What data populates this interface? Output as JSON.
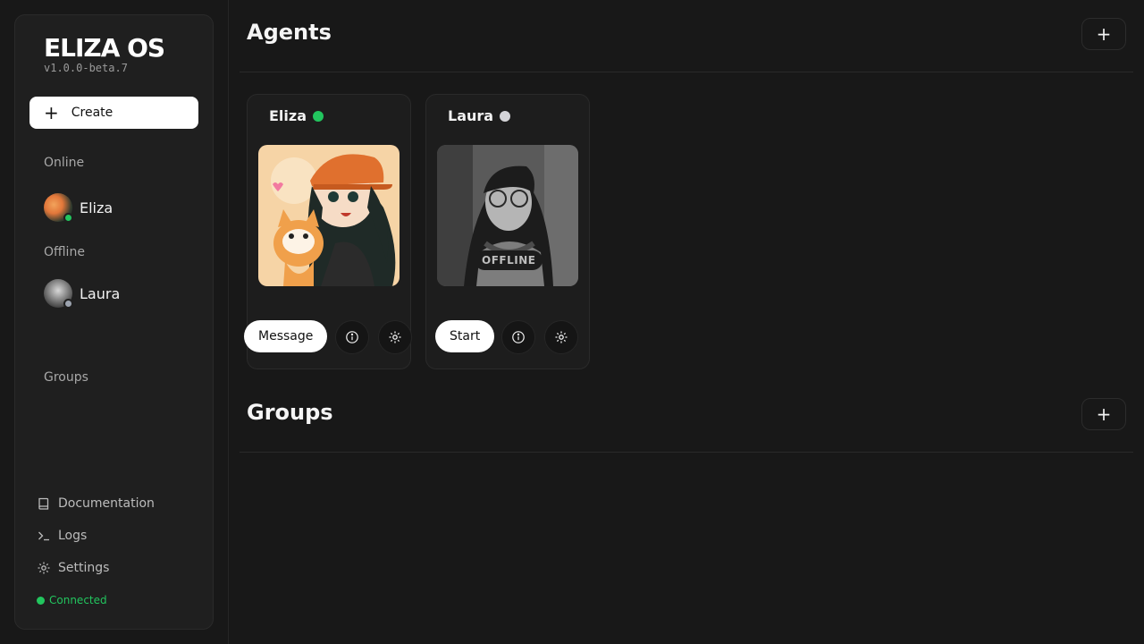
{
  "app": {
    "logo": "ELIZA OS",
    "version": "v1.0.0-beta.7"
  },
  "sidebar": {
    "create_label": "Create",
    "online_label": "Online",
    "offline_label": "Offline",
    "groups_label": "Groups",
    "online_agents": [
      {
        "name": "Eliza",
        "status": "online"
      }
    ],
    "offline_agents": [
      {
        "name": "Laura",
        "status": "offline"
      }
    ],
    "nav": {
      "documentation": "Documentation",
      "logs": "Logs",
      "settings": "Settings"
    },
    "connection_status": "Connected"
  },
  "main": {
    "agents_title": "Agents",
    "groups_title": "Groups",
    "add_symbol": "+",
    "cards": [
      {
        "name": "Eliza",
        "status": "online",
        "primary_action": "Message"
      },
      {
        "name": "Laura",
        "status": "offline",
        "primary_action": "Start",
        "badge": "OFFLINE"
      }
    ]
  },
  "colors": {
    "online": "#22c55e",
    "offline": "#9ca3af",
    "offline_card_dot": "#d4d4d8",
    "background": "#181818"
  }
}
